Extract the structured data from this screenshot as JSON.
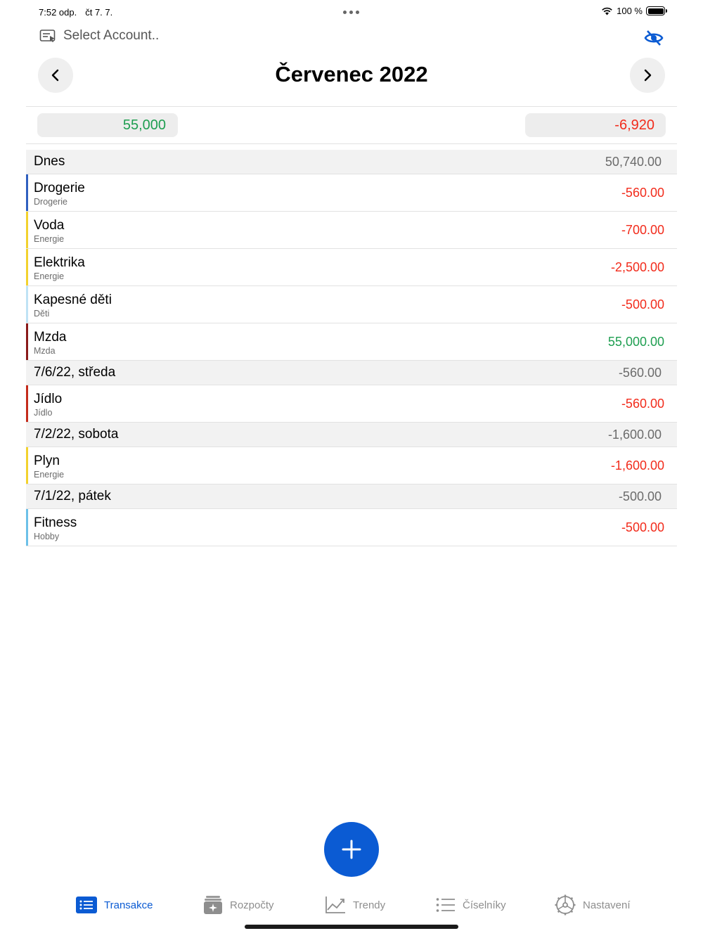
{
  "status": {
    "time": "7:52 odp.",
    "date": "čt 7. 7.",
    "battery": "100 %"
  },
  "header": {
    "account_label": "Select Account..",
    "month_title": "Červenec 2022"
  },
  "summary": {
    "income": "55,000",
    "expense": "-6,920"
  },
  "sections": [
    {
      "title": "Dnes",
      "total": "50,740.00",
      "rows": [
        {
          "name": "Drogerie",
          "category": "Drogerie",
          "amount": "-560.00",
          "color": "#2f5fbf"
        },
        {
          "name": "Voda",
          "category": "Energie",
          "amount": "-700.00",
          "color": "#f2d22e"
        },
        {
          "name": "Elektrika",
          "category": "Energie",
          "amount": "-2,500.00",
          "color": "#f2d22e"
        },
        {
          "name": "Kapesné děti",
          "category": "Děti",
          "amount": "-500.00",
          "color": "#bfe3f5"
        },
        {
          "name": "Mzda",
          "category": "Mzda",
          "amount": "55,000.00",
          "color": "#8a1a1a"
        }
      ]
    },
    {
      "title": "7/6/22, středa",
      "total": "-560.00",
      "rows": [
        {
          "name": "Jídlo",
          "category": "Jídlo",
          "amount": "-560.00",
          "color": "#c42b1b"
        }
      ]
    },
    {
      "title": "7/2/22, sobota",
      "total": "-1,600.00",
      "rows": [
        {
          "name": "Plyn",
          "category": "Energie",
          "amount": "-1,600.00",
          "color": "#f2d22e"
        }
      ]
    },
    {
      "title": "7/1/22, pátek",
      "total": "-500.00",
      "rows": [
        {
          "name": "Fitness",
          "category": "Hobby",
          "amount": "-500.00",
          "color": "#6cc0e8"
        }
      ]
    }
  ],
  "tabs": {
    "transakce": "Transakce",
    "rozpocty": "Rozpočty",
    "trendy": "Trendy",
    "ciselniky": "Číselníky",
    "nastaveni": "Nastavení"
  },
  "colors": {
    "accent": "#0b5bd3",
    "income": "#1e9e50",
    "expense": "#f22b1b"
  }
}
